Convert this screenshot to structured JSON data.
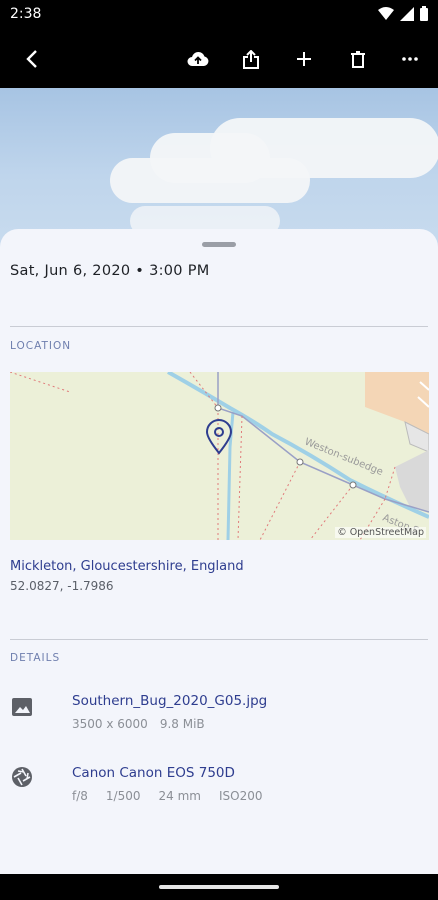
{
  "status": {
    "time": "2:38"
  },
  "toolbar": {
    "back": "back",
    "cloud_upload": "cloud-upload",
    "share": "share",
    "add": "add",
    "delete": "delete",
    "more": "more"
  },
  "info": {
    "date": "Sat, Jun 6, 2020 • 3:00 PM",
    "location_title": "LOCATION",
    "map_credit": "© OpenStreetMap",
    "map_labels": {
      "road1": "Weston-subedge",
      "road2": "Aston S"
    },
    "place": "Mickleton, Gloucestershire, England",
    "coords": "52.0827, -1.7986",
    "details_title": "DETAILS",
    "file": {
      "name": "Southern_Bug_2020_G05.jpg",
      "resolution": "3500 x 6000",
      "size": "9.8 MiB"
    },
    "camera": {
      "model": "Canon Canon EOS 750D",
      "aperture": "f/8",
      "shutter": "1/500",
      "focal": "24 mm",
      "iso": "ISO200"
    }
  },
  "colors": {
    "accent": "#2e3d8f",
    "sheet": "#f3f5fb"
  }
}
